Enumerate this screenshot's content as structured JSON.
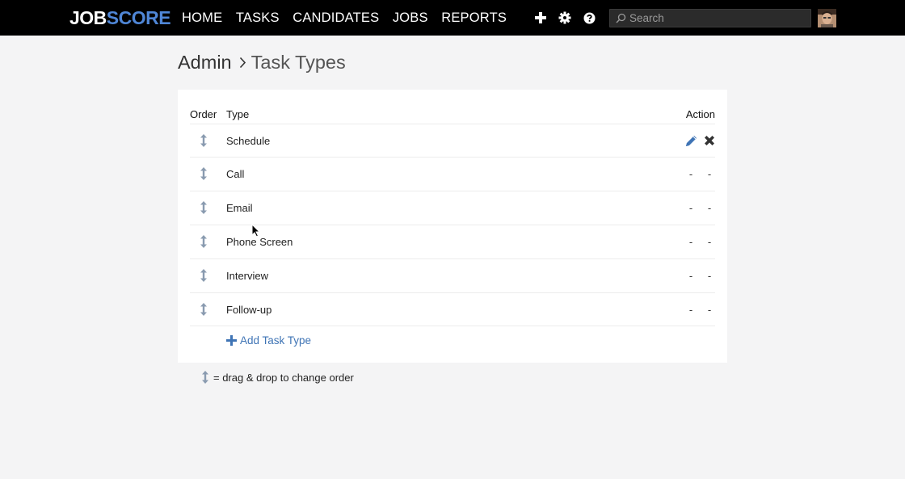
{
  "nav": {
    "logo_job": "JOB",
    "logo_score": "SCORE",
    "items": [
      "HOME",
      "TASKS",
      "CANDIDATES",
      "JOBS",
      "REPORTS"
    ],
    "search_placeholder": "Search"
  },
  "breadcrumb": {
    "parent": "Admin",
    "separator": ">",
    "current": "Task Types"
  },
  "table": {
    "headers": {
      "order": "Order",
      "type": "Type",
      "action": "Action"
    },
    "rows": [
      {
        "label": "Schedule",
        "edit": "pencil-icon",
        "delete": "close-icon"
      },
      {
        "label": "Call",
        "edit": "-",
        "delete": "-"
      },
      {
        "label": "Email",
        "edit": "-",
        "delete": "-"
      },
      {
        "label": "Phone Screen",
        "edit": "-",
        "delete": "-"
      },
      {
        "label": "Interview",
        "edit": "-",
        "delete": "-"
      },
      {
        "label": "Follow-up",
        "edit": "-",
        "delete": "-"
      }
    ]
  },
  "add_label": "Add Task Type",
  "legend_text": "= drag & drop to change order",
  "colors": {
    "accent": "#3f74b5",
    "logo_accent": "#4f86d6",
    "drag_icon": "#8a9bb0"
  }
}
